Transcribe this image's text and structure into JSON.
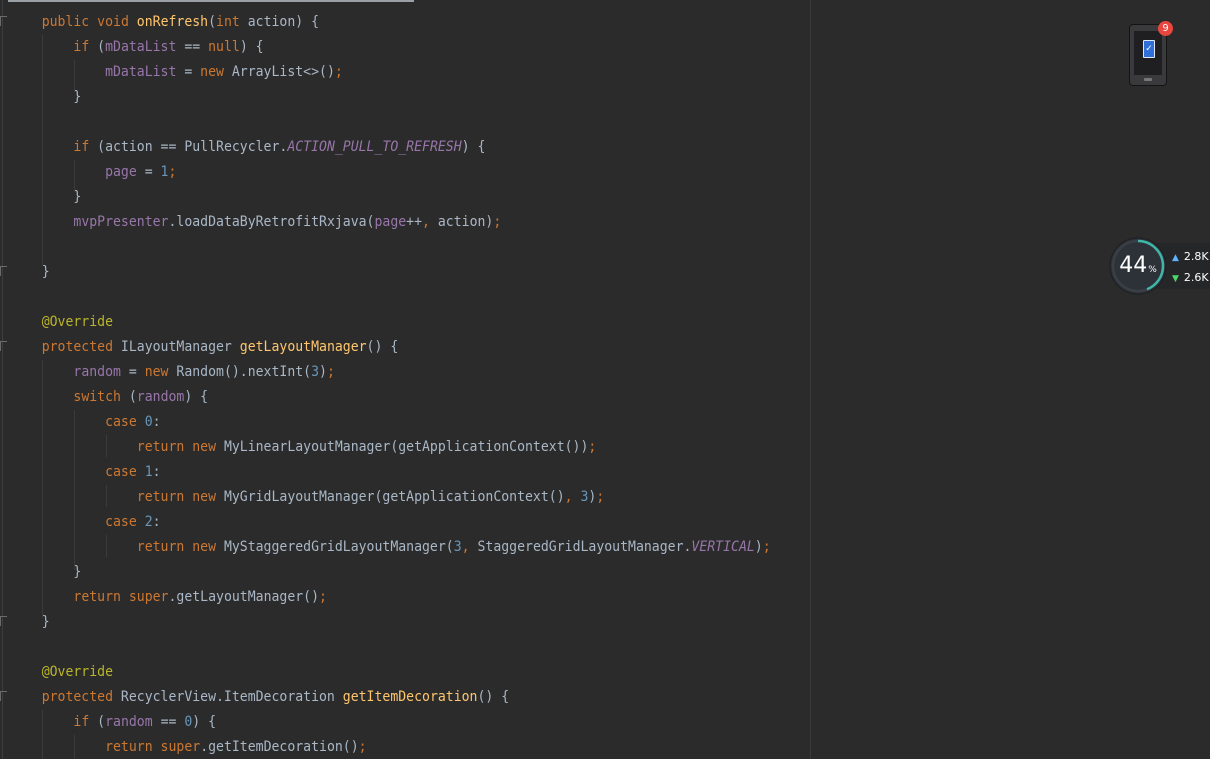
{
  "editor": {
    "lines": [
      [
        "    ",
        "public ",
        "void ",
        "onRefresh",
        "(",
        "int ",
        "action) {"
      ],
      [
        "        ",
        "if ",
        "(",
        "mDataList ",
        "== ",
        "null",
        ") {"
      ],
      [
        "            ",
        "mDataList ",
        "= ",
        "new ",
        "ArrayList<>()",
        ";"
      ],
      [
        "        ",
        "}"
      ],
      [
        ""
      ],
      [
        "        ",
        "if ",
        "(action == PullRecycler.",
        "ACTION_PULL_TO_REFRESH",
        ") {"
      ],
      [
        "            ",
        "page ",
        "= ",
        "1",
        ";"
      ],
      [
        "        ",
        "}"
      ],
      [
        "        ",
        "mvpPresenter",
        ".loadDataByRetrofitRxjava(",
        "page",
        "++",
        ", ",
        "action)",
        ";"
      ],
      [
        ""
      ],
      [
        "    ",
        "}"
      ],
      [
        ""
      ],
      [
        "    ",
        "@Override"
      ],
      [
        "    ",
        "protected ",
        "ILayoutManager ",
        "getLayoutManager",
        "() {"
      ],
      [
        "        ",
        "random ",
        "= ",
        "new ",
        "Random().nextInt(",
        "3",
        ")",
        ";"
      ],
      [
        "        ",
        "switch ",
        "(",
        "random",
        ") {"
      ],
      [
        "            ",
        "case ",
        "0",
        ":"
      ],
      [
        "                ",
        "return ",
        "new ",
        "MyLinearLayoutManager(getApplicationContext())",
        ";"
      ],
      [
        "            ",
        "case ",
        "1",
        ":"
      ],
      [
        "                ",
        "return ",
        "new ",
        "MyGridLayoutManager(getApplicationContext()",
        ", ",
        "3",
        ")",
        ";"
      ],
      [
        "            ",
        "case ",
        "2",
        ":"
      ],
      [
        "                ",
        "return ",
        "new ",
        "MyStaggeredGridLayoutManager(",
        "3",
        ", ",
        "StaggeredGridLayoutManager.",
        "VERTICAL",
        ")",
        ";"
      ],
      [
        "        ",
        "}"
      ],
      [
        "        ",
        "return ",
        "super",
        ".getLayoutManager()",
        ";"
      ],
      [
        "    ",
        "}"
      ],
      [
        ""
      ],
      [
        "    ",
        "@Override"
      ],
      [
        "    ",
        "protected ",
        "RecyclerView.ItemDecoration ",
        "getItemDecoration",
        "() {"
      ],
      [
        "        ",
        "if ",
        "(",
        "random ",
        "== ",
        "0",
        ") {"
      ],
      [
        "            ",
        "return ",
        "super",
        ".getItemDecoration()",
        ";"
      ]
    ],
    "styles": [
      [
        "p",
        "kw",
        "kw",
        "fn",
        "p",
        "kw",
        "p"
      ],
      [
        "p",
        "kw",
        "p",
        "fld",
        "p",
        "kw",
        "p"
      ],
      [
        "p",
        "fld",
        "p",
        "kw",
        "p",
        "kw"
      ],
      [
        "p",
        "p"
      ],
      [
        "p"
      ],
      [
        "p",
        "kw",
        "p",
        "cst",
        "p"
      ],
      [
        "p",
        "fld",
        "p",
        "num",
        "kw"
      ],
      [
        "p",
        "p"
      ],
      [
        "p",
        "fld",
        "p",
        "fld",
        "p",
        "kw",
        "p",
        "kw"
      ],
      [
        "p"
      ],
      [
        "p",
        "p"
      ],
      [
        "p"
      ],
      [
        "p",
        "ann"
      ],
      [
        "p",
        "kw",
        "p",
        "fn",
        "p"
      ],
      [
        "p",
        "fld",
        "p",
        "kw",
        "p",
        "num",
        "p",
        "kw"
      ],
      [
        "p",
        "kw",
        "p",
        "fld",
        "p"
      ],
      [
        "p",
        "kw",
        "num",
        "p"
      ],
      [
        "p",
        "kw",
        "kw",
        "p",
        "kw"
      ],
      [
        "p",
        "kw",
        "num",
        "p"
      ],
      [
        "p",
        "kw",
        "kw",
        "p",
        "kw",
        "num",
        "p",
        "kw"
      ],
      [
        "p",
        "kw",
        "num",
        "p"
      ],
      [
        "p",
        "kw",
        "kw",
        "p",
        "num",
        "kw",
        "p",
        "cst",
        "p",
        "kw"
      ],
      [
        "p",
        "p"
      ],
      [
        "p",
        "kw",
        "kw",
        "p",
        "kw"
      ],
      [
        "p",
        "p"
      ],
      [
        "p"
      ],
      [
        "p",
        "ann"
      ],
      [
        "p",
        "kw",
        "p",
        "fn",
        "p"
      ],
      [
        "p",
        "kw",
        "p",
        "fld",
        "p",
        "num",
        "p"
      ],
      [
        "p",
        "kw",
        "kw",
        "p",
        "kw"
      ]
    ]
  },
  "phone_widget": {
    "badge_count": "9",
    "icon": "phone-battery-icon",
    "battery_glyph": "✓"
  },
  "memory_widget": {
    "percent": 44,
    "value": "44",
    "unit": "%",
    "ring_color": "#3fb6a8"
  },
  "network_widget": {
    "upload": "2.8K",
    "download": "2.6K",
    "upload_icon": "arrow-up-icon",
    "download_icon": "arrow-down-icon"
  },
  "colors": {
    "background": "#2b2b2b",
    "keyword": "#cc7832",
    "function": "#ffc66d",
    "field": "#9876aa",
    "number": "#6897bb",
    "annotation": "#bbb529",
    "plain": "#a9b7c6"
  }
}
